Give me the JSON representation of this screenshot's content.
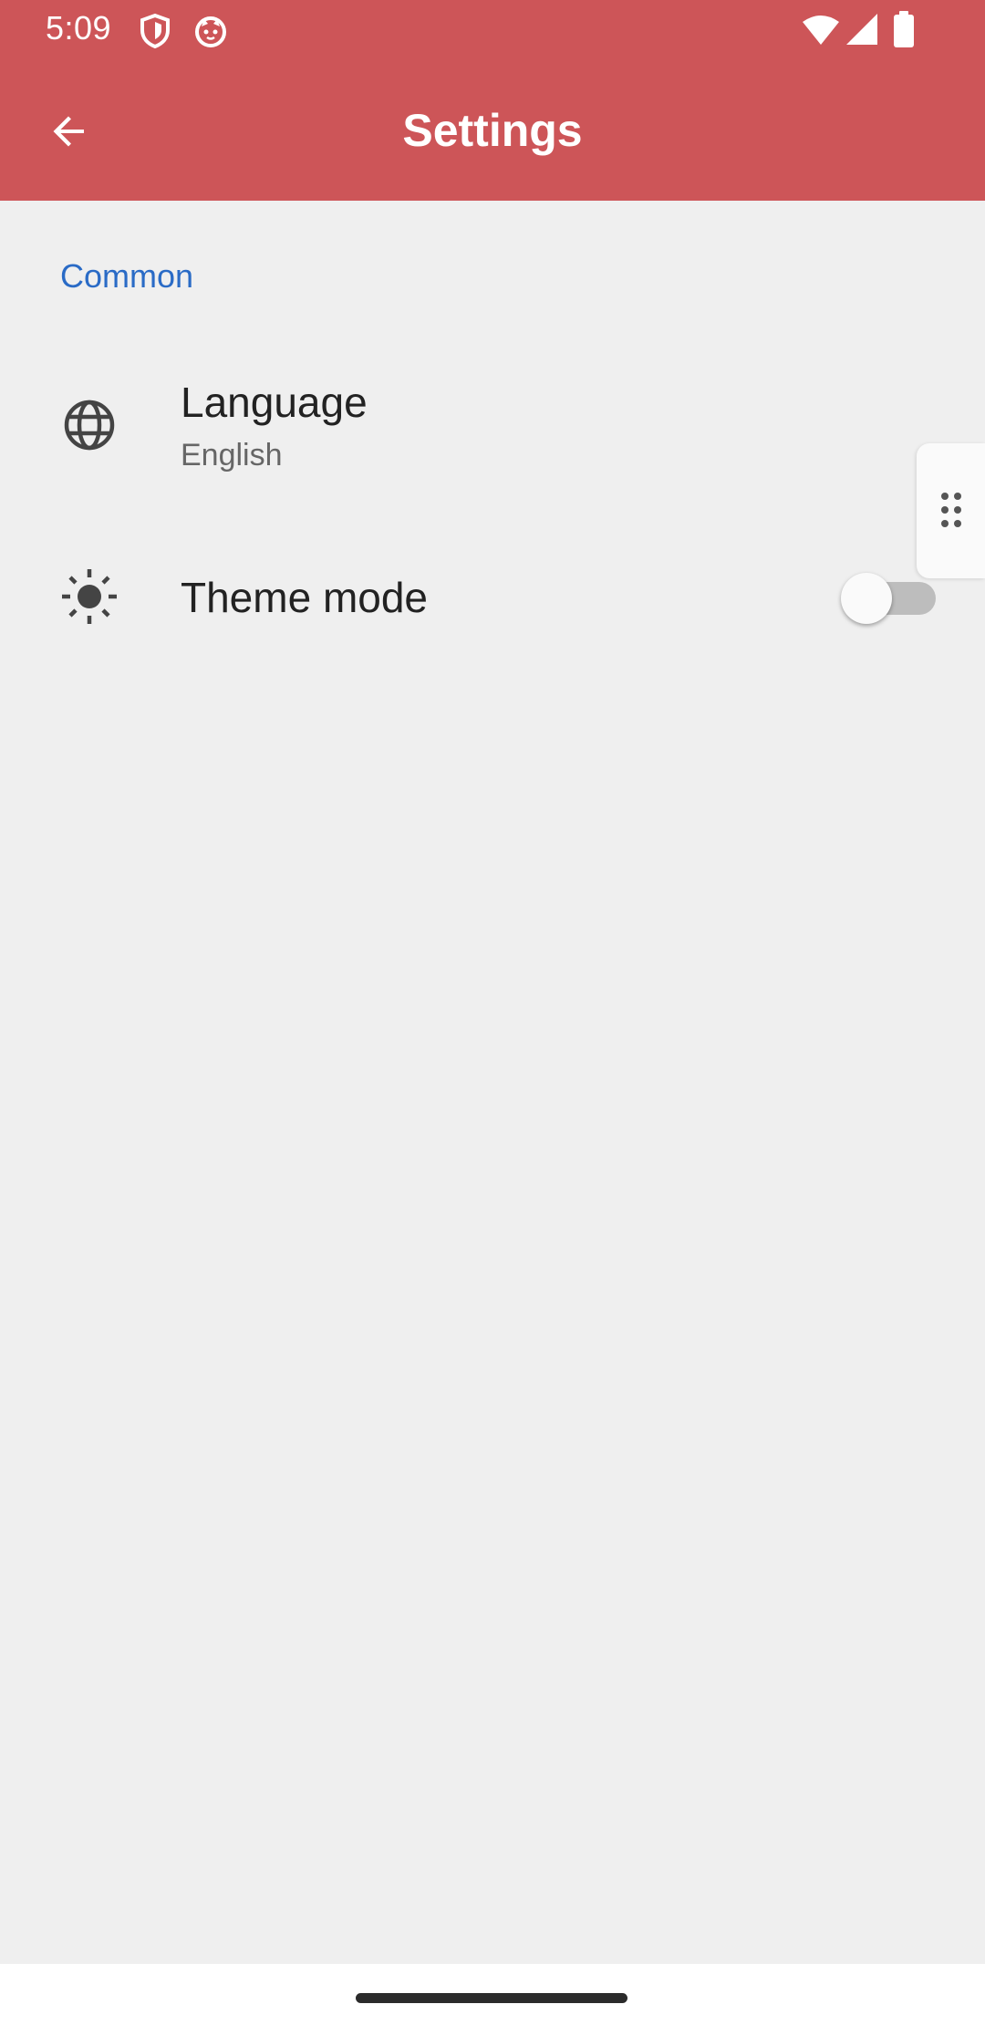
{
  "status_bar": {
    "time": "5:09",
    "icons": [
      "shield-icon",
      "cat-face-icon",
      "wifi-icon",
      "signal-icon",
      "battery-icon"
    ]
  },
  "toolbar": {
    "title": "Settings",
    "back_icon": "arrow-back-icon"
  },
  "settings": {
    "section_header": "Common",
    "items": [
      {
        "title": "Language",
        "summary": "English",
        "icon": "globe-icon"
      },
      {
        "title": "Theme mode",
        "icon": "brightness-icon",
        "switch_on": false
      }
    ]
  },
  "colors": {
    "app_bar": "#cd5558",
    "section_header": "#2a6bc6",
    "background": "#efefef"
  }
}
